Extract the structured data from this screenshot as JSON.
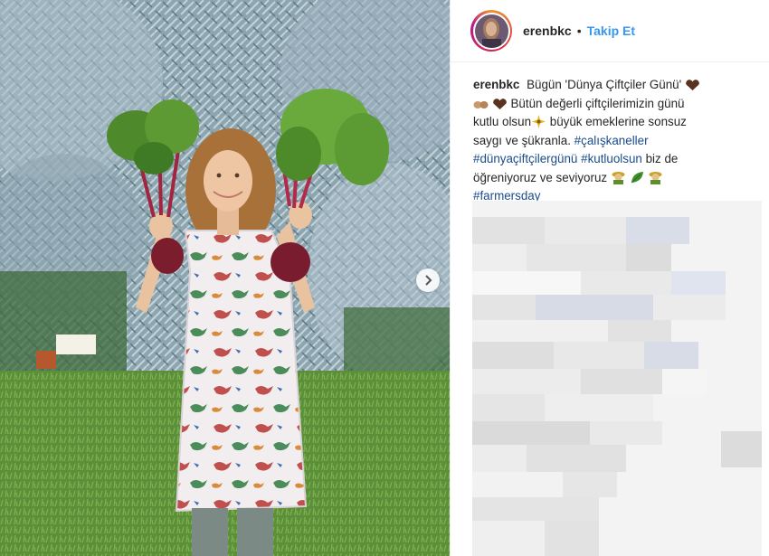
{
  "header": {
    "username": "erenbkc",
    "separator": "•",
    "follow_label": "Takip Et"
  },
  "caption": {
    "username": "erenbkc",
    "line1": "Bügün 'Dünya Çiftçiler Günü'",
    "line2": "Bütün değerli çiftçilerimizin günü",
    "line3a": "kutlu olsun",
    "line3b": "büyük emeklerine sonsuz",
    "line4": "saygı ve şükranla.",
    "tag1": "#çalışkaneller",
    "tag2": "#dünyaçiftçilergünü",
    "tag3": "#kutluolsun",
    "line6": "biz de",
    "line7": "öğreniyoruz ve seviyoruz",
    "tag4": "#farmersday"
  },
  "icons": {
    "next": "chevron-right-icon",
    "emoji_1": "brown-heart-emoji",
    "emoji_2": "hands-emoji",
    "emoji_3": "sparkle-emoji",
    "emoji_4": "farmer-emoji",
    "emoji_5": "leaf-emoji"
  },
  "colors": {
    "follow": "#3897f0",
    "hashtag": "#1a4c8c",
    "text": "#262626"
  }
}
